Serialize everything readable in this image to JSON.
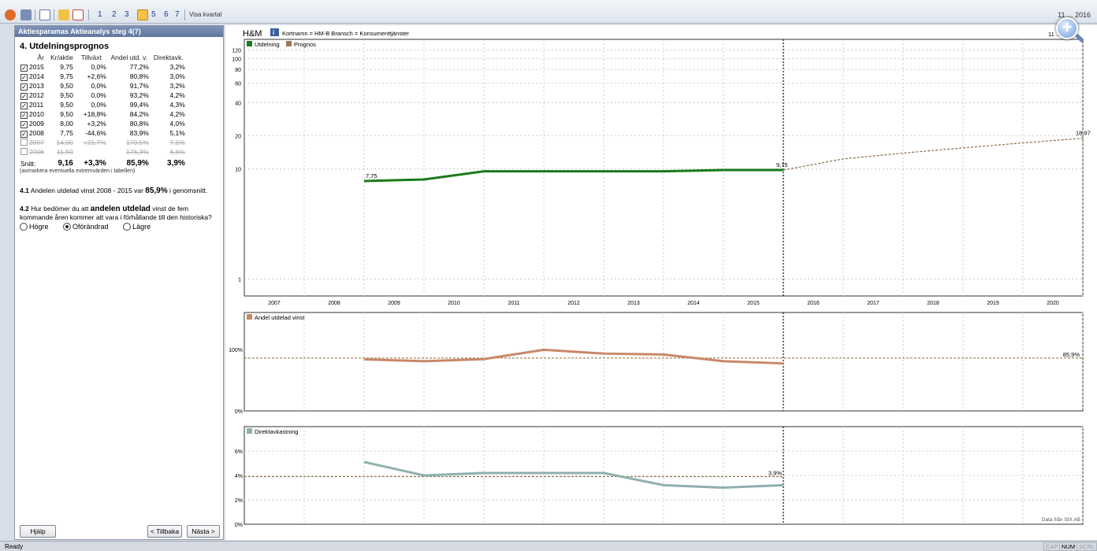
{
  "toolbar": {
    "steps": [
      "1",
      "2",
      "3",
      "4",
      "5",
      "6",
      "7"
    ],
    "visa_kvartal": "Visa kvartal",
    "date": "11 ... 2016"
  },
  "left": {
    "header": "Aktiesparamas Aktieanalys steg 4(7)",
    "title": "4. Utdelningsprognos",
    "columns": [
      "År",
      "Kr/aktie",
      "Tillväxt",
      "Andel utd. v.",
      "Direktavk."
    ],
    "rows": [
      {
        "year": "2015",
        "kr": "9,75",
        "growth": "0,0%",
        "share": "77,2%",
        "yield": "3,2%",
        "checked": true
      },
      {
        "year": "2014",
        "kr": "9,75",
        "growth": "+2,6%",
        "share": "80,8%",
        "yield": "3,0%",
        "checked": true
      },
      {
        "year": "2013",
        "kr": "9,50",
        "growth": "0,0%",
        "share": "91,7%",
        "yield": "3,2%",
        "checked": true
      },
      {
        "year": "2012",
        "kr": "9,50",
        "growth": "0,0%",
        "share": "93,2%",
        "yield": "4,2%",
        "checked": true
      },
      {
        "year": "2011",
        "kr": "9,50",
        "growth": "0,0%",
        "share": "99,4%",
        "yield": "4,3%",
        "checked": true
      },
      {
        "year": "2010",
        "kr": "9,50",
        "growth": "+18,8%",
        "share": "84,2%",
        "yield": "4,2%",
        "checked": true
      },
      {
        "year": "2009",
        "kr": "8,00",
        "growth": "+3,2%",
        "share": "80,8%",
        "yield": "4,0%",
        "checked": true
      },
      {
        "year": "2008",
        "kr": "7,75",
        "growth": "-44,6%",
        "share": "83,9%",
        "yield": "5,1%",
        "checked": true
      },
      {
        "year": "2007",
        "kr": "14,00",
        "growth": "+21,7%",
        "share": "170,5%",
        "yield": "7,1%",
        "checked": false
      },
      {
        "year": "2006",
        "kr": "11,50",
        "growth": "",
        "share": "176,3%",
        "yield": "6,6%",
        "checked": false
      }
    ],
    "snitt": {
      "label": "Snitt:",
      "kr": "9,16",
      "growth": "+3,3%",
      "share": "85,9%",
      "yield": "3,9%"
    },
    "note": "(avmarkera eventuella extremvärden i tabellen)",
    "p41_num": "4.1",
    "p41_text": " Andelen utdelad vinst 2008 - 2015 var ",
    "p41_value": "85,9%",
    "p41_tail": " i genomsnitt.",
    "p42_num": "4.2",
    "p42_a": " Hur bedömer du att ",
    "p42_bold": "andelen utdelad",
    "p42_b": " vinst de fem kommande åren kommer att vara i förhållande till den historiska?",
    "options": [
      "Högre",
      "Oförändrad",
      "Lägre"
    ],
    "selected_option": 1,
    "buttons": {
      "help": "Hjälp",
      "back": "< Tillbaka",
      "next": "Nästa >"
    }
  },
  "chart_header": {
    "company": "H&M",
    "info_icon": "i",
    "details": "Kortnamn = HM-B   Bransch = Konsumenttjänster",
    "date": "11 ... 16"
  },
  "chart_data": [
    {
      "type": "line",
      "title": "",
      "legend": [
        "Utdelning",
        "Prognos"
      ],
      "log_scale": true,
      "y_ticks": [
        "1",
        "10",
        "20",
        "40",
        "60",
        "80",
        "100",
        "120"
      ],
      "x": [
        "2007",
        "2008",
        "2009",
        "2010",
        "2011",
        "2012",
        "2013",
        "2014",
        "2015",
        "2016",
        "2017",
        "2018",
        "2019",
        "2020"
      ],
      "series": [
        {
          "name": "Utdelning",
          "color": "#1a7a1a",
          "x": [
            2008.5,
            2009.5,
            2010.5,
            2011.5,
            2012.5,
            2013.5,
            2014.5,
            2015.5
          ],
          "values": [
            7.75,
            8.0,
            9.5,
            9.5,
            9.5,
            9.5,
            9.75,
            9.75
          ]
        },
        {
          "name": "Prognos",
          "color": "#8a6a4a",
          "x": [
            2015.5,
            2016.5,
            2017.5,
            2018.5,
            2019.5,
            2020.5
          ],
          "values": [
            9.75,
            12.3,
            13.9,
            15.5,
            17.2,
            18.97
          ]
        }
      ],
      "labels": [
        {
          "x": 2008.5,
          "y": 7.75,
          "text": "7,75"
        },
        {
          "x": 2015.5,
          "y": 9.75,
          "text": "9,75"
        },
        {
          "x": 2020.5,
          "y": 18.97,
          "text": "18,97"
        }
      ]
    },
    {
      "type": "line",
      "title": "",
      "legend": [
        "Andel utdelad vinst"
      ],
      "y_ticks": [
        "0%",
        "100%"
      ],
      "ylim": [
        0,
        160
      ],
      "series": [
        {
          "name": "Andel utdelad vinst",
          "color": "#c8886a",
          "x": [
            2008.5,
            2009.5,
            2010.5,
            2011.5,
            2012.5,
            2013.5,
            2014.5,
            2015.5
          ],
          "values": [
            83.9,
            80.8,
            84.2,
            99.4,
            93.2,
            91.7,
            80.8,
            77.2
          ]
        }
      ],
      "average": {
        "value": 85.9,
        "label": "85,9%"
      }
    },
    {
      "type": "line",
      "title": "",
      "legend": [
        "Direktavkastning"
      ],
      "y_ticks": [
        "0%",
        "2%",
        "4%",
        "6%"
      ],
      "ylim": [
        0,
        8
      ],
      "series": [
        {
          "name": "Direktavkastning",
          "color": "#8fb0ae",
          "x": [
            2008.5,
            2009.5,
            2010.5,
            2011.5,
            2012.5,
            2013.5,
            2014.5,
            2015.5
          ],
          "values": [
            5.1,
            4.0,
            4.2,
            4.2,
            4.2,
            3.2,
            3.0,
            3.2
          ]
        }
      ],
      "average": {
        "value": 3.9,
        "label": "3,9%"
      },
      "source": "Data från SIX AB"
    }
  ],
  "status": {
    "ready": "Ready",
    "caps": "CAP",
    "num": "NUM",
    "scrl": "SCRL"
  }
}
